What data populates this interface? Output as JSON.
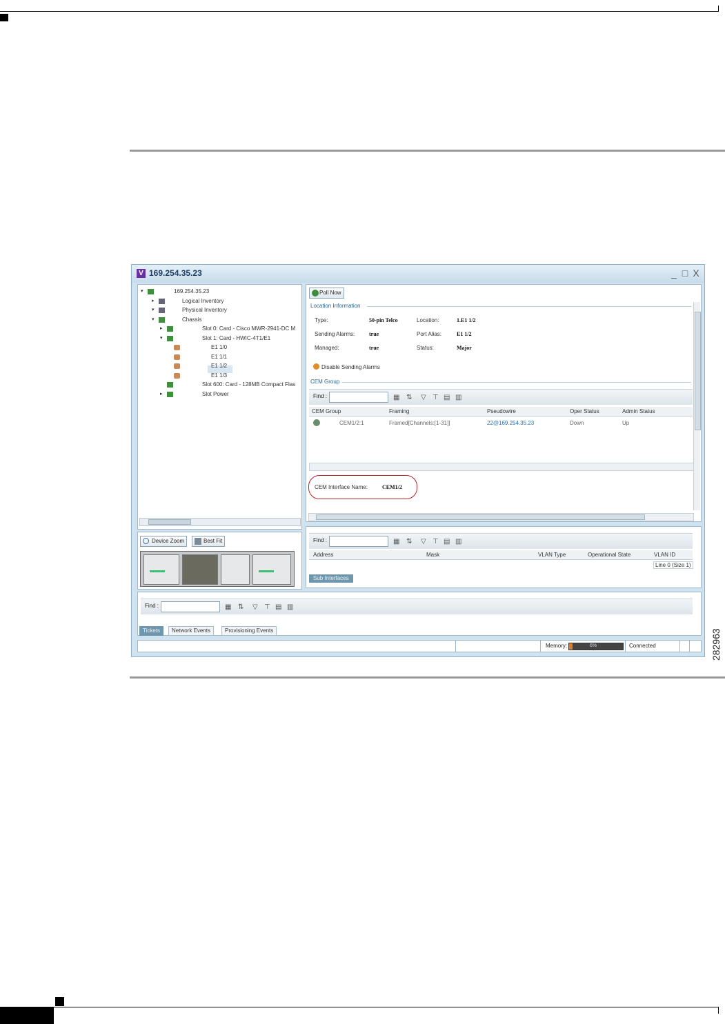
{
  "figure_number": "282963",
  "window": {
    "title": "169.254.35.23",
    "app_icon": "V",
    "controls": {
      "minimize": "_",
      "maximize": "□",
      "close": "X"
    }
  },
  "tree": {
    "items": [
      {
        "label": "169.254.35.23",
        "icon": "network-element-icon",
        "level": 0,
        "expanded": true
      },
      {
        "label": "Logical Inventory",
        "icon": "logical-inventory-icon",
        "level": 1,
        "expanded": false
      },
      {
        "label": "Physical Inventory",
        "icon": "physical-inventory-icon",
        "level": 1,
        "expanded": true
      },
      {
        "label": "Chassis",
        "icon": "chassis-icon",
        "level": 2,
        "expanded": true
      },
      {
        "label": "Slot 0: Card - Cisco MWR-2941-DC M",
        "icon": "card-icon",
        "level": 3,
        "expanded": false
      },
      {
        "label": "Slot 1: Card - HWIC-4T1/E1",
        "icon": "card-icon",
        "level": 3,
        "expanded": true
      },
      {
        "label": "E1 1/0",
        "icon": "port-icon",
        "level": 4
      },
      {
        "label": "E1 1/1",
        "icon": "port-icon",
        "level": 4
      },
      {
        "label": "E1 1/2",
        "icon": "port-icon",
        "level": 4,
        "selected": true
      },
      {
        "label": "E1 1/3",
        "icon": "port-icon",
        "level": 4
      },
      {
        "label": "Slot 600: Card - 128MB Compact Flas",
        "icon": "card-icon",
        "level": 3
      },
      {
        "label": "Slot Power",
        "icon": "card-icon",
        "level": 3,
        "expanded": false
      }
    ]
  },
  "zoom": {
    "device_zoom": "Device Zoom",
    "best_fit": "Best Fit"
  },
  "properties": {
    "poll_now": "Poll Now",
    "location_section": "Location Information",
    "fields": {
      "type_label": "Type:",
      "type_value": "50-pin Telco",
      "location_label": "Location:",
      "location_value": "1.E1 1/2",
      "sending_alarms_label": "Sending Alarms:",
      "sending_alarms_value": "true",
      "port_alias_label": "Port Alias:",
      "port_alias_value": "E1 1/2",
      "managed_label": "Managed:",
      "managed_value": "true",
      "status_label": "Status:",
      "status_value": "Major"
    },
    "disable_alarms": "Disable Sending Alarms",
    "cem_section": "CEM Group",
    "find_label": "Find :",
    "cem_columns": [
      "CEM Group",
      "Framing",
      "Pseudowire",
      "Oper Status",
      "Admin Status"
    ],
    "cem_rows": [
      {
        "cem_group": "CEM1/2:1",
        "framing": "Framed[Channels:[1-31]]",
        "pseudowire": "22@169.254.35.23",
        "oper_status": "Down",
        "admin_status": "Up"
      }
    ],
    "cem_interface_label": "CEM Interface Name:",
    "cem_interface_value": "CEM1/2"
  },
  "sub_interfaces": {
    "find_label": "Find :",
    "columns": [
      "Address",
      "Mask",
      "VLAN Type",
      "Operational State",
      "VLAN ID"
    ],
    "line_info": "Line 0 (Size 1)",
    "tab": "Sub Interfaces"
  },
  "bottom": {
    "find_label": "Find :",
    "tabs": [
      "Tickets",
      "Network Events",
      "Provisioning Events"
    ],
    "active_tab": 0
  },
  "status": {
    "memory_label": "Memory:",
    "memory_percent": "6%",
    "memory_fraction": 0.06,
    "connection": "Connected"
  },
  "colors": {
    "highlight_ring": "#b3232b",
    "link": "#2470b6",
    "tab_active": "#6e97ae"
  }
}
